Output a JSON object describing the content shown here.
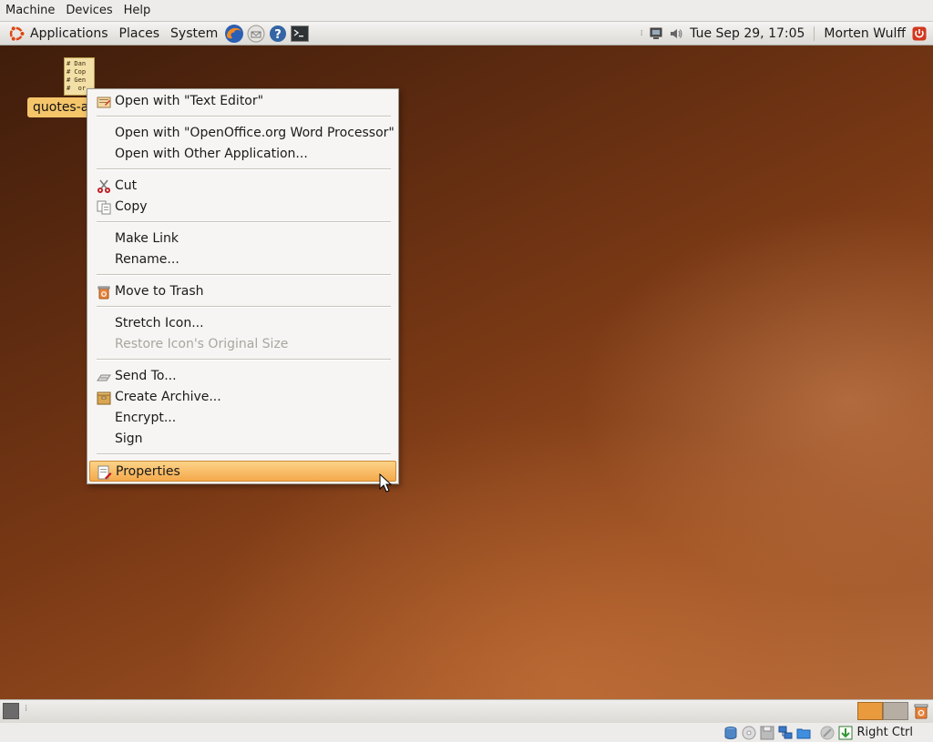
{
  "host_menubar": {
    "items": [
      "Machine",
      "Devices",
      "Help"
    ]
  },
  "top_panel": {
    "menus": [
      "Applications",
      "Places",
      "System"
    ],
    "launchers": [
      "firefox-icon",
      "mail-icon",
      "help-icon",
      "terminal-icon"
    ],
    "clock": "Tue Sep 29, 17:05",
    "user": "Morten Wulff"
  },
  "desktop": {
    "file_icon_text": "# Dan\n# Cop\n# Gen\n#  or",
    "file_label": "quotes-al"
  },
  "context_menu": {
    "items": [
      {
        "label": "Open with \"Text Editor\"",
        "icon": "text-editor-icon"
      },
      {
        "label": "Open with \"OpenOffice.org Word Processor\""
      },
      {
        "label": "Open with Other Application..."
      },
      {
        "label": "Cut",
        "icon": "scissors-icon"
      },
      {
        "label": "Copy",
        "icon": "copy-icon"
      },
      {
        "label": "Make Link"
      },
      {
        "label": "Rename..."
      },
      {
        "label": "Move to Trash",
        "icon": "trash-icon"
      },
      {
        "label": "Stretch Icon..."
      },
      {
        "label": "Restore Icon's Original Size",
        "disabled": true
      },
      {
        "label": "Send To...",
        "icon": "send-icon"
      },
      {
        "label": "Create Archive...",
        "icon": "archive-icon"
      },
      {
        "label": "Encrypt..."
      },
      {
        "label": "Sign"
      },
      {
        "label": "Properties",
        "icon": "properties-icon",
        "selected": true
      }
    ]
  },
  "statusbar": {
    "host_key": "Right Ctrl"
  },
  "colors": {
    "accent": "#f5a94c",
    "desktop_dark": "#3f1d0b",
    "desktop_light": "#b36a3a"
  }
}
